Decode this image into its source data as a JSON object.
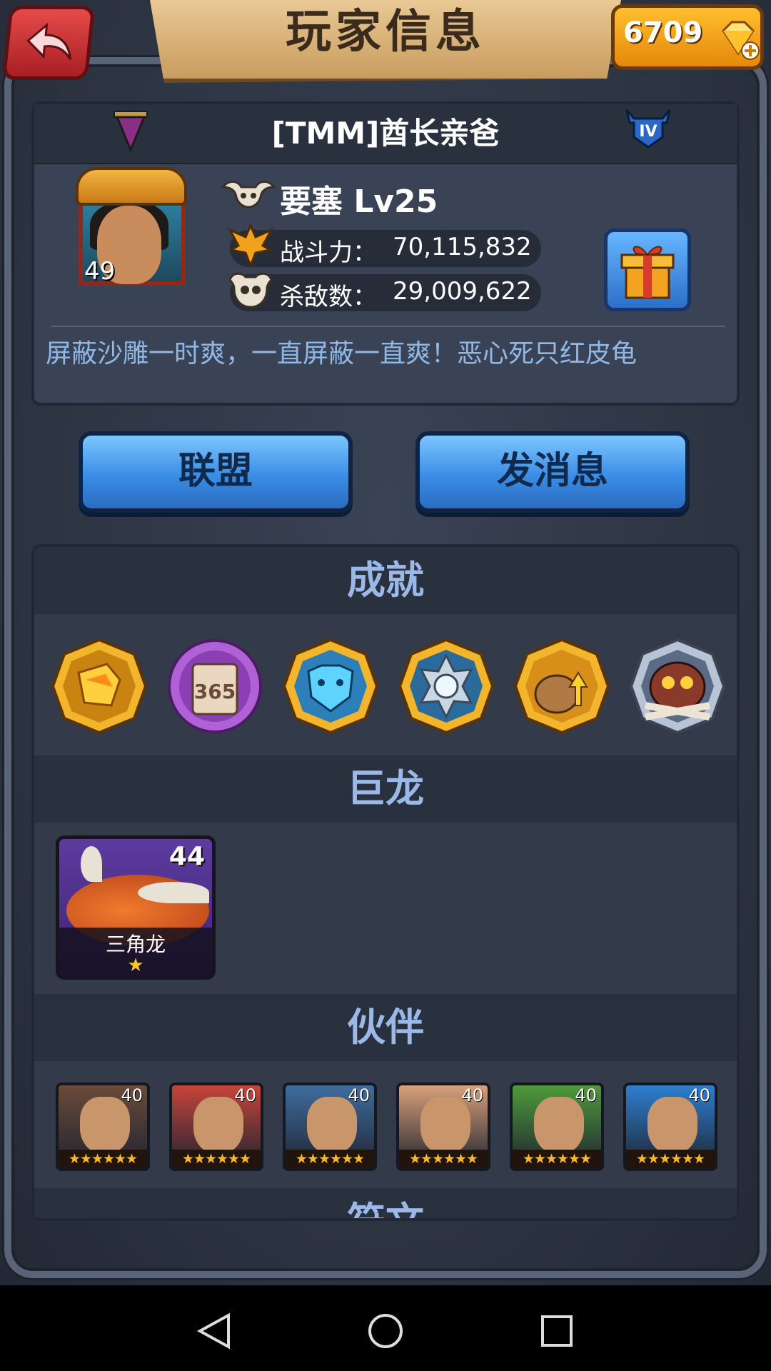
{
  "header": {
    "title": "玩家信息",
    "gems": "6709"
  },
  "player": {
    "name": "[TMM]酋长亲爸",
    "rank": "IV",
    "avatar_level": "49",
    "fortress": "要塞 Lv25",
    "power_label": "战斗力：",
    "power_value": "70,115,832",
    "kills_label": "杀敌数：",
    "kills_value": "29,009,622",
    "motto": "屏蔽沙雕一时爽，一直屏蔽一直爽！恶心死只红皮龟"
  },
  "buttons": {
    "alliance": "联盟",
    "message": "发消息"
  },
  "sections": {
    "achievements_title": "成就",
    "dragons_title": "巨龙",
    "partners_title": "伙伴",
    "next_title": "符文"
  },
  "achievements": [
    {
      "icon": "gold-shards-icon"
    },
    {
      "icon": "calendar-365-icon",
      "text": "365"
    },
    {
      "icon": "blue-beast-icon"
    },
    {
      "icon": "steel-gear-icon"
    },
    {
      "icon": "resource-bag-icon"
    },
    {
      "icon": "owl-skull-icon"
    }
  ],
  "dragon": {
    "name": "三角龙",
    "level": "44",
    "stars": "★"
  },
  "partners": [
    {
      "level": "40",
      "stars": "★★★★★★",
      "color": "#6b4a3a"
    },
    {
      "level": "40",
      "stars": "★★★★★★",
      "color": "#c7443a"
    },
    {
      "level": "40",
      "stars": "★★★★★★",
      "color": "#3f6d9e"
    },
    {
      "level": "40",
      "stars": "★★★★★★",
      "color": "#d9a07a"
    },
    {
      "level": "40",
      "stars": "★★★★★★",
      "color": "#4f9a3c"
    },
    {
      "level": "40",
      "stars": "★★★★★★",
      "color": "#2d7fd0"
    }
  ],
  "colors": {
    "accent_blue": "#3b8ee6",
    "section_title": "#9bb9e8",
    "motto": "#8fb8e6",
    "gem_gold": "#ffbf2e",
    "back_red": "#d63a3c"
  }
}
